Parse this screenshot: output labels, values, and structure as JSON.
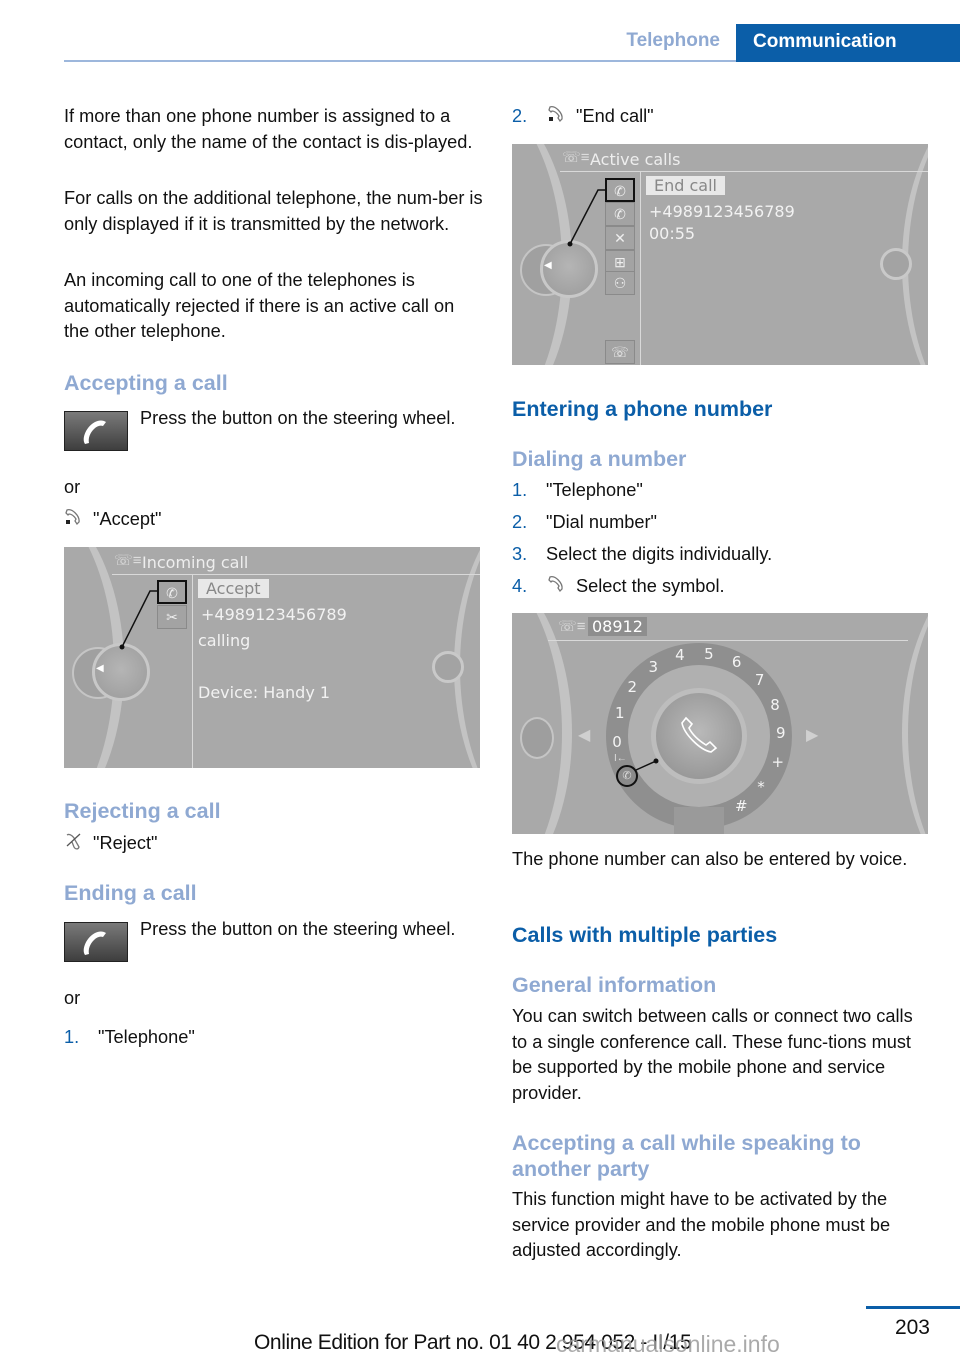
{
  "header": {
    "section": "Telephone",
    "chapter": "Communication"
  },
  "left": {
    "paragraphs": [
      "If more than one phone number is assigned to a contact, only the name of the contact is dis-played.",
      "For calls on the additional telephone, the num-ber is only displayed if it is transmitted by the network.",
      "An incoming call to one of the telephones is automatically rejected if there is an active call on the other telephone."
    ],
    "accepting": {
      "heading": "Accepting a call",
      "button_text": "Press the button on the steering wheel.",
      "or": "or",
      "menu_text": "\"Accept\"",
      "screen": {
        "title": "Incoming call",
        "highlight": "Accept",
        "number": "+4989123456789",
        "status": "calling",
        "device": "Device: Handy 1"
      }
    },
    "rejecting": {
      "heading": "Rejecting a call",
      "menu_text": "\"Reject\""
    },
    "ending": {
      "heading": "Ending a call",
      "button_text": "Press the button on the steering wheel.",
      "or": "or",
      "steps": [
        {
          "num": "1.",
          "text": "\"Telephone\""
        }
      ]
    }
  },
  "right": {
    "ending_steps": [
      {
        "num": "2.",
        "text": "\"End call\""
      }
    ],
    "active_screen": {
      "title": "Active calls",
      "highlight": "End call",
      "number": "+4989123456789",
      "duration": "00:55"
    },
    "entering": {
      "heading": "Entering a phone number",
      "subheading": "Dialing a number",
      "steps": [
        {
          "num": "1.",
          "text": "\"Telephone\""
        },
        {
          "num": "2.",
          "text": "\"Dial number\""
        },
        {
          "num": "3.",
          "text": "Select the digits individually."
        },
        {
          "num": "4.",
          "text": "Select the symbol."
        }
      ],
      "dial_screen": {
        "entered": "08912",
        "digits": [
          "0",
          "1",
          "2",
          "3",
          "4",
          "5",
          "6",
          "7",
          "8",
          "9",
          "+",
          "*",
          "#"
        ]
      },
      "voice_text": "The phone number can also be entered by voice."
    },
    "multiple": {
      "heading": "Calls with multiple parties",
      "general_heading": "General information",
      "general_text": "You can switch between calls or connect two calls to a single conference call. These func-tions must be supported by the mobile phone and service provider.",
      "accepting_heading": "Accepting a call while speaking to another party",
      "accepting_text": "This function might have to be activated by the service provider and the mobile phone must be adjusted accordingly."
    }
  },
  "footer": {
    "page_number": "203",
    "edition": "Online Edition for Part no. 01 40 2 954 052 - II/15",
    "watermark": "carmanualsonline.info"
  }
}
